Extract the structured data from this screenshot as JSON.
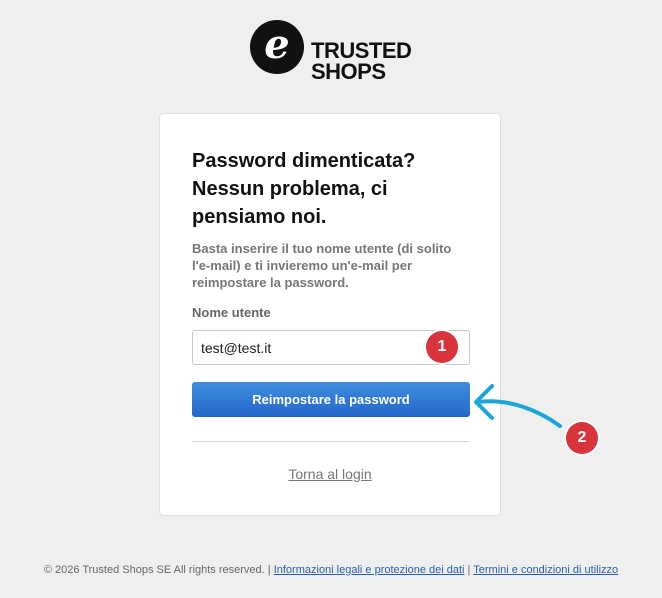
{
  "logo": {
    "mark": "e",
    "line1": "TRUSTED",
    "line2": "SHOPS"
  },
  "card": {
    "heading": "Password dimenticata? Nessun problema, ci pensiamo noi.",
    "description": "Basta inserire il tuo nome utente (di solito l'e-mail) e ti invieremo un'e-mail per reimpostare la password.",
    "username_label": "Nome utente",
    "username_value": "test@test.it",
    "submit_label": "Reimpostare la password",
    "back_link": "Torna al login"
  },
  "annotations": {
    "badge1": "1",
    "badge2": "2",
    "accent_color": "#1aa7d8",
    "badge_color": "#d9333b"
  },
  "footer": {
    "copyright": "© 2026 Trusted Shops SE All rights reserved.",
    "separator": "|",
    "legal_link": "Informazioni legali e protezione dei dati",
    "terms_link": "Termini e condizioni di utilizzo"
  }
}
